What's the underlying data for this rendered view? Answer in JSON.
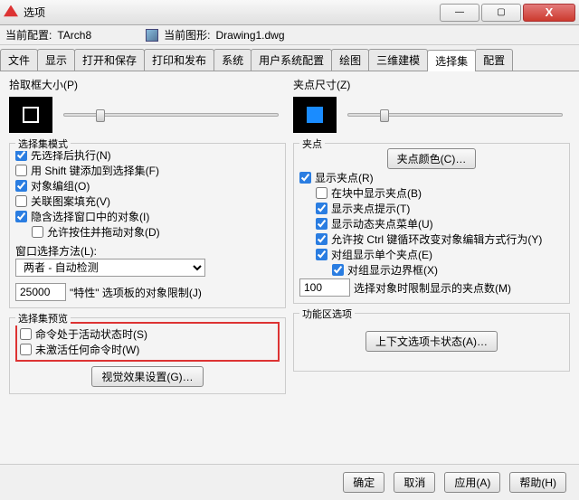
{
  "window": {
    "title": "选项",
    "min": "—",
    "max": "▢",
    "close": "X"
  },
  "info": {
    "profileLabel": "当前配置:",
    "profileValue": "TArch8",
    "drawingLabel": "当前图形:",
    "drawingValue": "Drawing1.dwg"
  },
  "tabs": [
    "文件",
    "显示",
    "打开和保存",
    "打印和发布",
    "系统",
    "用户系统配置",
    "绘图",
    "三维建模",
    "选择集",
    "配置"
  ],
  "left": {
    "pickboxTitle": "拾取框大小(P)",
    "modeTitle": "选择集模式",
    "m1": "先选择后执行(N)",
    "m2": "用 Shift 键添加到选择集(F)",
    "m3": "对象编组(O)",
    "m4": "关联图案填充(V)",
    "m5": "隐含选择窗口中的对象(I)",
    "m6": "允许按住并拖动对象(D)",
    "winTitle": "窗口选择方法(L):",
    "winSel": "两者 - 自动检测",
    "limLabel": "\"特性\" 选项板的对象限制(J)",
    "limVal": "25000",
    "previewTitle": "选择集预览",
    "pv1": "命令处于活动状态时(S)",
    "pv2": "未激活任何命令时(W)",
    "pvBtn": "视觉效果设置(G)…"
  },
  "right": {
    "gripSizeTitle": "夹点尺寸(Z)",
    "gripTitle": "夹点",
    "gripColorBtn": "夹点颜色(C)…",
    "g1": "显示夹点(R)",
    "g2": "在块中显示夹点(B)",
    "g3": "显示夹点提示(T)",
    "g4": "显示动态夹点菜单(U)",
    "g5": "允许按 Ctrl 键循环改变对象编辑方式行为(Y)",
    "g6": "对组显示单个夹点(E)",
    "g7": "对组显示边界框(X)",
    "glimLabel": "选择对象时限制显示的夹点数(M)",
    "glimVal": "100",
    "ribbonTitle": "功能区选项",
    "ribbonBtn": "上下文选项卡状态(A)…"
  },
  "footer": {
    "ok": "确定",
    "cancel": "取消",
    "apply": "应用(A)",
    "help": "帮助(H)"
  }
}
